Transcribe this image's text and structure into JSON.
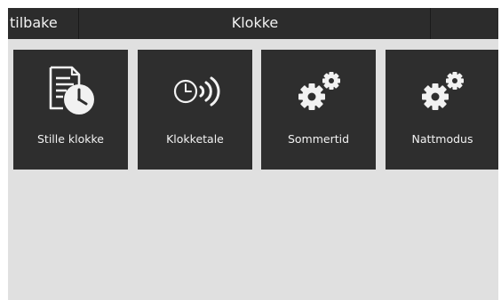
{
  "header": {
    "back_label": "tilbake",
    "title": "Klokke"
  },
  "tiles": [
    {
      "label": "Stille klokke",
      "icon": "document-clock-icon"
    },
    {
      "label": "Klokketale",
      "icon": "speaking-clock-icon"
    },
    {
      "label": "Sommertid",
      "icon": "gears-icon"
    },
    {
      "label": "Nattmodus",
      "icon": "gears-icon"
    }
  ],
  "colors": {
    "background": "#e0e0e0",
    "topbar": "#2c2c2c",
    "tile": "#2e2e2e",
    "text": "#f2f2f2"
  }
}
